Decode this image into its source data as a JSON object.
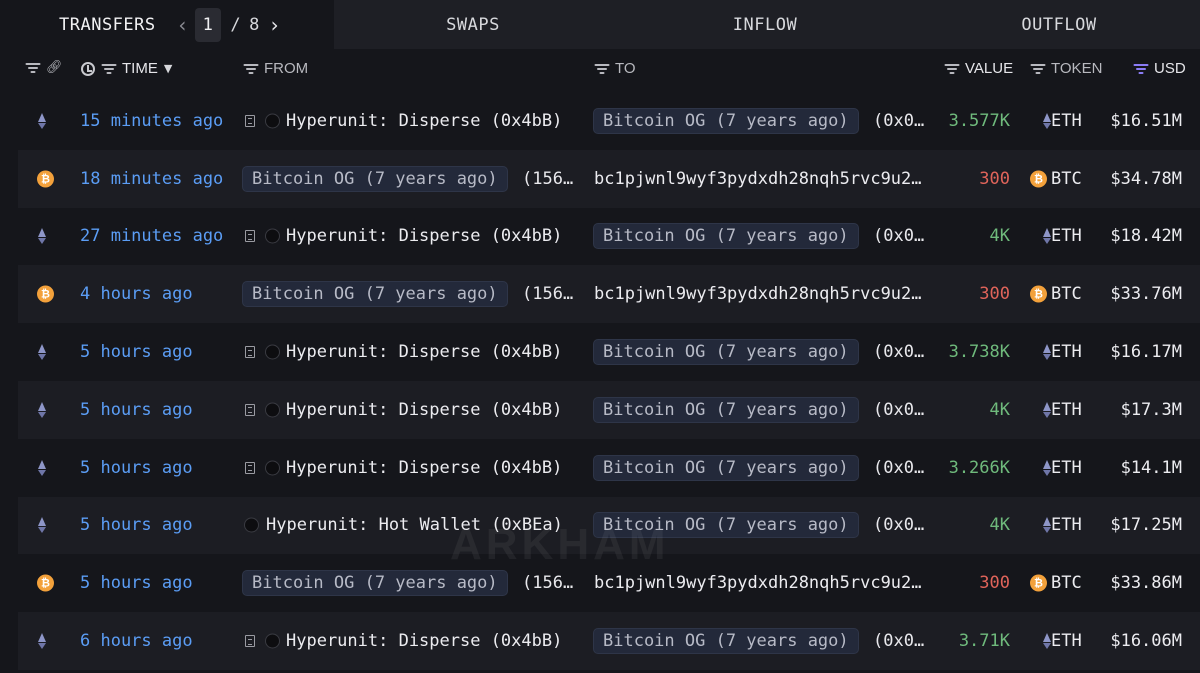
{
  "tabs": {
    "transfers": "TRANSFERS",
    "page_current": "1",
    "page_sep": "/",
    "page_total": "8",
    "swaps": "SWAPS",
    "inflow": "INFLOW",
    "outflow": "OUTFLOW"
  },
  "columns": {
    "time": "TIME",
    "from": "FROM",
    "to": "TO",
    "value": "VALUE",
    "token": "TOKEN",
    "usd": "USD"
  },
  "colors": {
    "accent": "#5b9df5",
    "positive": "#6fba7c",
    "negative": "#e0645a",
    "btc": "#f3a13b",
    "usd_filter": "#8b7cf6"
  },
  "watermark": "ARKHAM",
  "rows": [
    {
      "chain": "eth-icon",
      "time": "15 minutes ago",
      "from": "Hyperunit: Disperse (0x4bB)",
      "to": "Bitcoin OG (7 years ago)",
      "to_suffix": "(0x0…",
      "value": "3.577K",
      "token": "ETH",
      "usd": "$16.51M"
    },
    {
      "chain": "btc-icon",
      "time": "18 minutes ago",
      "from": "Bitcoin OG (7 years ago)",
      "from_suffix": "(156…",
      "to": "bc1pjwnl9wyf3pydxdh28nqh5rvc9u2…",
      "value": "300",
      "token": "BTC",
      "usd": "$34.78M"
    },
    {
      "chain": "eth-icon",
      "time": "27 minutes ago",
      "from": "Hyperunit: Disperse (0x4bB)",
      "to": "Bitcoin OG (7 years ago)",
      "to_suffix": "(0x0…",
      "value": "4K",
      "token": "ETH",
      "usd": "$18.42M"
    },
    {
      "chain": "btc-icon",
      "time": "4 hours ago",
      "from": "Bitcoin OG (7 years ago)",
      "from_suffix": "(156…",
      "to": "bc1pjwnl9wyf3pydxdh28nqh5rvc9u2…",
      "value": "300",
      "token": "BTC",
      "usd": "$33.76M"
    },
    {
      "chain": "eth-icon",
      "time": "5 hours ago",
      "from": "Hyperunit: Disperse (0x4bB)",
      "to": "Bitcoin OG (7 years ago)",
      "to_suffix": "(0x0…",
      "value": "3.738K",
      "token": "ETH",
      "usd": "$16.17M"
    },
    {
      "chain": "eth-icon",
      "time": "5 hours ago",
      "from": "Hyperunit: Disperse (0x4bB)",
      "to": "Bitcoin OG (7 years ago)",
      "to_suffix": "(0x0…",
      "value": "4K",
      "token": "ETH",
      "usd": "$17.3M"
    },
    {
      "chain": "eth-icon",
      "time": "5 hours ago",
      "from": "Hyperunit: Disperse (0x4bB)",
      "to": "Bitcoin OG (7 years ago)",
      "to_suffix": "(0x0…",
      "value": "3.266K",
      "token": "ETH",
      "usd": "$14.1M"
    },
    {
      "chain": "eth-icon",
      "time": "5 hours ago",
      "from": "Hyperunit: Hot Wallet (0xBEa)",
      "to": "Bitcoin OG (7 years ago)",
      "to_suffix": "(0x0…",
      "value": "4K",
      "token": "ETH",
      "usd": "$17.25M"
    },
    {
      "chain": "btc-icon",
      "time": "5 hours ago",
      "from": "Bitcoin OG (7 years ago)",
      "from_suffix": "(156…",
      "to": "bc1pjwnl9wyf3pydxdh28nqh5rvc9u2…",
      "value": "300",
      "token": "BTC",
      "usd": "$33.86M"
    },
    {
      "chain": "eth-icon",
      "time": "6 hours ago",
      "from": "Hyperunit: Disperse (0x4bB)",
      "to": "Bitcoin OG (7 years ago)",
      "to_suffix": "(0x0…",
      "value": "3.71K",
      "token": "ETH",
      "usd": "$16.06M"
    }
  ]
}
